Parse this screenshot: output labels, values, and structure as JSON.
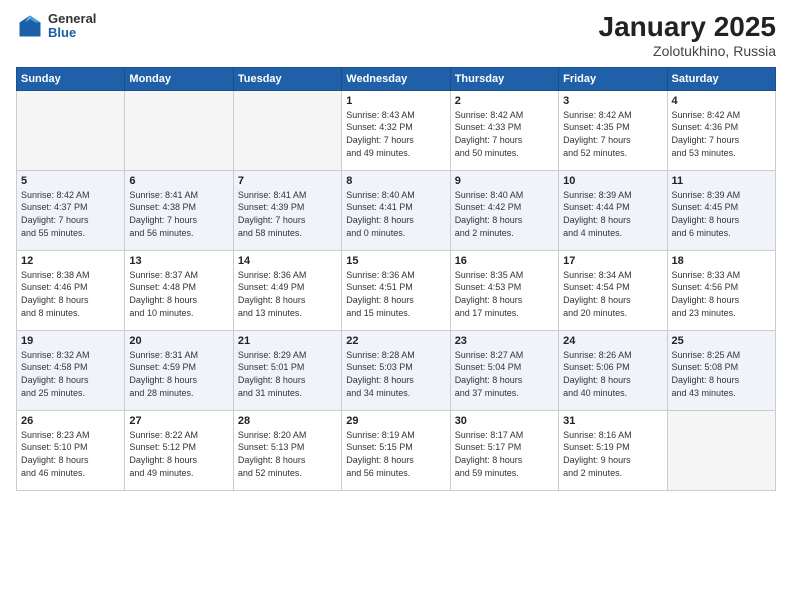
{
  "logo": {
    "general": "General",
    "blue": "Blue"
  },
  "title": "January 2025",
  "subtitle": "Zolotukhino, Russia",
  "headers": [
    "Sunday",
    "Monday",
    "Tuesday",
    "Wednesday",
    "Thursday",
    "Friday",
    "Saturday"
  ],
  "weeks": [
    [
      {
        "day": "",
        "info": ""
      },
      {
        "day": "",
        "info": ""
      },
      {
        "day": "",
        "info": ""
      },
      {
        "day": "1",
        "info": "Sunrise: 8:43 AM\nSunset: 4:32 PM\nDaylight: 7 hours\nand 49 minutes."
      },
      {
        "day": "2",
        "info": "Sunrise: 8:42 AM\nSunset: 4:33 PM\nDaylight: 7 hours\nand 50 minutes."
      },
      {
        "day": "3",
        "info": "Sunrise: 8:42 AM\nSunset: 4:35 PM\nDaylight: 7 hours\nand 52 minutes."
      },
      {
        "day": "4",
        "info": "Sunrise: 8:42 AM\nSunset: 4:36 PM\nDaylight: 7 hours\nand 53 minutes."
      }
    ],
    [
      {
        "day": "5",
        "info": "Sunrise: 8:42 AM\nSunset: 4:37 PM\nDaylight: 7 hours\nand 55 minutes."
      },
      {
        "day": "6",
        "info": "Sunrise: 8:41 AM\nSunset: 4:38 PM\nDaylight: 7 hours\nand 56 minutes."
      },
      {
        "day": "7",
        "info": "Sunrise: 8:41 AM\nSunset: 4:39 PM\nDaylight: 7 hours\nand 58 minutes."
      },
      {
        "day": "8",
        "info": "Sunrise: 8:40 AM\nSunset: 4:41 PM\nDaylight: 8 hours\nand 0 minutes."
      },
      {
        "day": "9",
        "info": "Sunrise: 8:40 AM\nSunset: 4:42 PM\nDaylight: 8 hours\nand 2 minutes."
      },
      {
        "day": "10",
        "info": "Sunrise: 8:39 AM\nSunset: 4:44 PM\nDaylight: 8 hours\nand 4 minutes."
      },
      {
        "day": "11",
        "info": "Sunrise: 8:39 AM\nSunset: 4:45 PM\nDaylight: 8 hours\nand 6 minutes."
      }
    ],
    [
      {
        "day": "12",
        "info": "Sunrise: 8:38 AM\nSunset: 4:46 PM\nDaylight: 8 hours\nand 8 minutes."
      },
      {
        "day": "13",
        "info": "Sunrise: 8:37 AM\nSunset: 4:48 PM\nDaylight: 8 hours\nand 10 minutes."
      },
      {
        "day": "14",
        "info": "Sunrise: 8:36 AM\nSunset: 4:49 PM\nDaylight: 8 hours\nand 13 minutes."
      },
      {
        "day": "15",
        "info": "Sunrise: 8:36 AM\nSunset: 4:51 PM\nDaylight: 8 hours\nand 15 minutes."
      },
      {
        "day": "16",
        "info": "Sunrise: 8:35 AM\nSunset: 4:53 PM\nDaylight: 8 hours\nand 17 minutes."
      },
      {
        "day": "17",
        "info": "Sunrise: 8:34 AM\nSunset: 4:54 PM\nDaylight: 8 hours\nand 20 minutes."
      },
      {
        "day": "18",
        "info": "Sunrise: 8:33 AM\nSunset: 4:56 PM\nDaylight: 8 hours\nand 23 minutes."
      }
    ],
    [
      {
        "day": "19",
        "info": "Sunrise: 8:32 AM\nSunset: 4:58 PM\nDaylight: 8 hours\nand 25 minutes."
      },
      {
        "day": "20",
        "info": "Sunrise: 8:31 AM\nSunset: 4:59 PM\nDaylight: 8 hours\nand 28 minutes."
      },
      {
        "day": "21",
        "info": "Sunrise: 8:29 AM\nSunset: 5:01 PM\nDaylight: 8 hours\nand 31 minutes."
      },
      {
        "day": "22",
        "info": "Sunrise: 8:28 AM\nSunset: 5:03 PM\nDaylight: 8 hours\nand 34 minutes."
      },
      {
        "day": "23",
        "info": "Sunrise: 8:27 AM\nSunset: 5:04 PM\nDaylight: 8 hours\nand 37 minutes."
      },
      {
        "day": "24",
        "info": "Sunrise: 8:26 AM\nSunset: 5:06 PM\nDaylight: 8 hours\nand 40 minutes."
      },
      {
        "day": "25",
        "info": "Sunrise: 8:25 AM\nSunset: 5:08 PM\nDaylight: 8 hours\nand 43 minutes."
      }
    ],
    [
      {
        "day": "26",
        "info": "Sunrise: 8:23 AM\nSunset: 5:10 PM\nDaylight: 8 hours\nand 46 minutes."
      },
      {
        "day": "27",
        "info": "Sunrise: 8:22 AM\nSunset: 5:12 PM\nDaylight: 8 hours\nand 49 minutes."
      },
      {
        "day": "28",
        "info": "Sunrise: 8:20 AM\nSunset: 5:13 PM\nDaylight: 8 hours\nand 52 minutes."
      },
      {
        "day": "29",
        "info": "Sunrise: 8:19 AM\nSunset: 5:15 PM\nDaylight: 8 hours\nand 56 minutes."
      },
      {
        "day": "30",
        "info": "Sunrise: 8:17 AM\nSunset: 5:17 PM\nDaylight: 8 hours\nand 59 minutes."
      },
      {
        "day": "31",
        "info": "Sunrise: 8:16 AM\nSunset: 5:19 PM\nDaylight: 9 hours\nand 2 minutes."
      },
      {
        "day": "",
        "info": ""
      }
    ]
  ]
}
